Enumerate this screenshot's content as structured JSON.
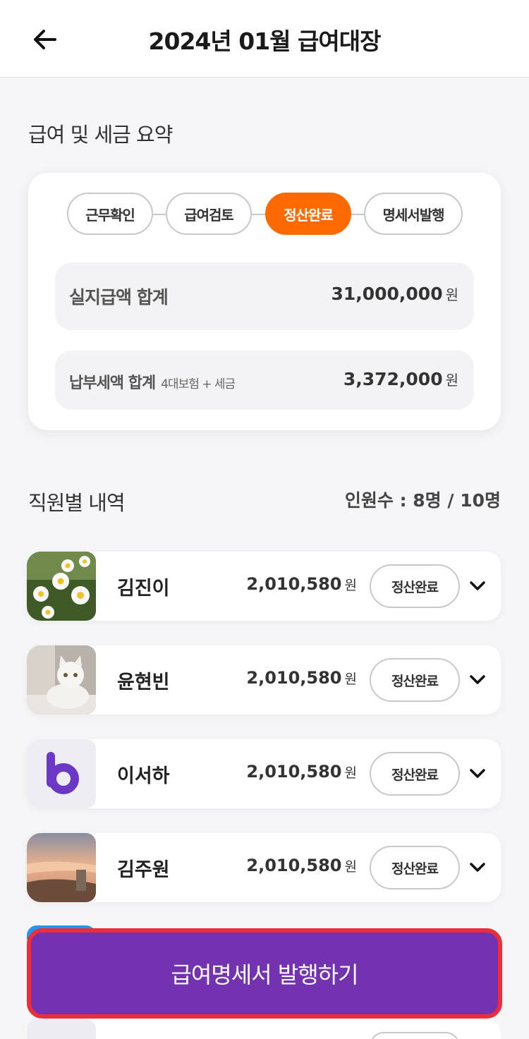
{
  "header": {
    "title": "2024년 01월 급여대장",
    "back_icon": "arrow-left-icon"
  },
  "summary": {
    "section_title": "급여 및 세금 요약",
    "steps": [
      {
        "label": "근무확인",
        "active": false
      },
      {
        "label": "급여검토",
        "active": false
      },
      {
        "label": "정산완료",
        "active": true
      },
      {
        "label": "명세서발행",
        "active": false
      }
    ],
    "net_pay": {
      "label": "실지급액 합계",
      "amount": "31,000,000",
      "unit": "원"
    },
    "tax": {
      "label": "납부세액 합계",
      "sub": "4대보험 + 세금",
      "amount": "3,372,000",
      "unit": "원"
    },
    "accent_color": "#ff6a00"
  },
  "employees": {
    "section_title": "직원별 내역",
    "headcount": "인원수 : 8명 / 10명",
    "list": [
      {
        "name": "김진이",
        "amount": "2,010,580",
        "unit": "원",
        "status": "정산완료",
        "avatar": "daisy-flowers-photo"
      },
      {
        "name": "윤현빈",
        "amount": "2,010,580",
        "unit": "원",
        "status": "정산완료",
        "avatar": "white-cat-photo"
      },
      {
        "name": "이서하",
        "amount": "2,010,580",
        "unit": "원",
        "status": "정산완료",
        "avatar": "purple-b-logo"
      },
      {
        "name": "김주원",
        "amount": "2,010,580",
        "unit": "원",
        "status": "정산완료",
        "avatar": "sunset-beach-photo"
      }
    ]
  },
  "bottom_button": {
    "label": "급여명세서 발행하기",
    "bg_color": "#7333b0",
    "border_color": "#ee2d38"
  }
}
